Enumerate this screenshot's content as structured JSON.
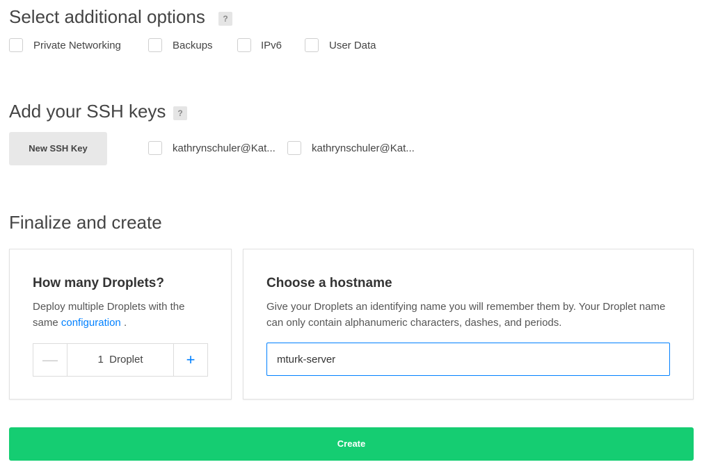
{
  "options": {
    "title": "Select additional options",
    "help": "?",
    "items": [
      {
        "label": "Private Networking"
      },
      {
        "label": "Backups"
      },
      {
        "label": "IPv6"
      },
      {
        "label": "User Data"
      }
    ]
  },
  "ssh": {
    "title": "Add your SSH keys",
    "help": "?",
    "new_key_label": "New SSH Key",
    "keys": [
      {
        "label": "kathrynschuler@Kat..."
      },
      {
        "label": "kathrynschuler@Kat..."
      }
    ]
  },
  "finalize": {
    "title": "Finalize and create",
    "droplets": {
      "title": "How many Droplets?",
      "desc_before": "Deploy multiple Droplets with the same",
      "desc_link": "configuration",
      "desc_after": ".",
      "minus": "—",
      "plus": "+",
      "count": "1",
      "unit": "Droplet"
    },
    "hostname": {
      "title": "Choose a hostname",
      "desc": "Give your Droplets an identifying name you will remember them by. Your Droplet name can only contain alphanumeric characters, dashes, and periods.",
      "value": "mturk-server"
    }
  },
  "create_label": "Create",
  "colors": {
    "accent": "#0080ff",
    "create": "#15cd72"
  }
}
